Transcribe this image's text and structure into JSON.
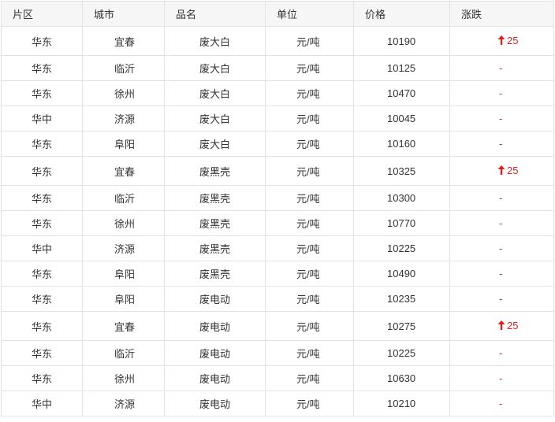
{
  "table": {
    "headers": [
      "片区",
      "城市",
      "品名",
      "单位",
      "价格",
      "涨跌"
    ],
    "rows": [
      {
        "region": "华东",
        "city": "宜春",
        "product": "废大白",
        "unit": "元/吨",
        "price": "10190",
        "change": "25",
        "trend": "up"
      },
      {
        "region": "华东",
        "city": "临沂",
        "product": "废大白",
        "unit": "元/吨",
        "price": "10125",
        "change": "-",
        "trend": "flat"
      },
      {
        "region": "华东",
        "city": "徐州",
        "product": "废大白",
        "unit": "元/吨",
        "price": "10470",
        "change": "-",
        "trend": "flat"
      },
      {
        "region": "华中",
        "city": "济源",
        "product": "废大白",
        "unit": "元/吨",
        "price": "10045",
        "change": "-",
        "trend": "flat"
      },
      {
        "region": "华东",
        "city": "阜阳",
        "product": "废大白",
        "unit": "元/吨",
        "price": "10160",
        "change": "-",
        "trend": "flat"
      },
      {
        "region": "华东",
        "city": "宜春",
        "product": "废黑壳",
        "unit": "元/吨",
        "price": "10325",
        "change": "25",
        "trend": "up"
      },
      {
        "region": "华东",
        "city": "临沂",
        "product": "废黑壳",
        "unit": "元/吨",
        "price": "10300",
        "change": "-",
        "trend": "flat"
      },
      {
        "region": "华东",
        "city": "徐州",
        "product": "废黑壳",
        "unit": "元/吨",
        "price": "10770",
        "change": "-",
        "trend": "flat"
      },
      {
        "region": "华中",
        "city": "济源",
        "product": "废黑壳",
        "unit": "元/吨",
        "price": "10225",
        "change": "-",
        "trend": "flat"
      },
      {
        "region": "华东",
        "city": "阜阳",
        "product": "废黑壳",
        "unit": "元/吨",
        "price": "10490",
        "change": "-",
        "trend": "flat"
      },
      {
        "region": "华东",
        "city": "阜阳",
        "product": "废电动",
        "unit": "元/吨",
        "price": "10235",
        "change": "-",
        "trend": "flat"
      },
      {
        "region": "华东",
        "city": "宜春",
        "product": "废电动",
        "unit": "元/吨",
        "price": "10275",
        "change": "25",
        "trend": "up"
      },
      {
        "region": "华东",
        "city": "临沂",
        "product": "废电动",
        "unit": "元/吨",
        "price": "10225",
        "change": "-",
        "trend": "flat"
      },
      {
        "region": "华东",
        "city": "徐州",
        "product": "废电动",
        "unit": "元/吨",
        "price": "10630",
        "change": "-",
        "trend": "flat"
      },
      {
        "region": "华中",
        "city": "济源",
        "product": "废电动",
        "unit": "元/吨",
        "price": "10210",
        "change": "-",
        "trend": "flat"
      }
    ]
  },
  "colors": {
    "up": "#e02020",
    "header_bg": "#f6f6f6",
    "border": "#e3e3e3",
    "text": "#333333"
  },
  "icons": {
    "up": "arrow-up-icon"
  }
}
